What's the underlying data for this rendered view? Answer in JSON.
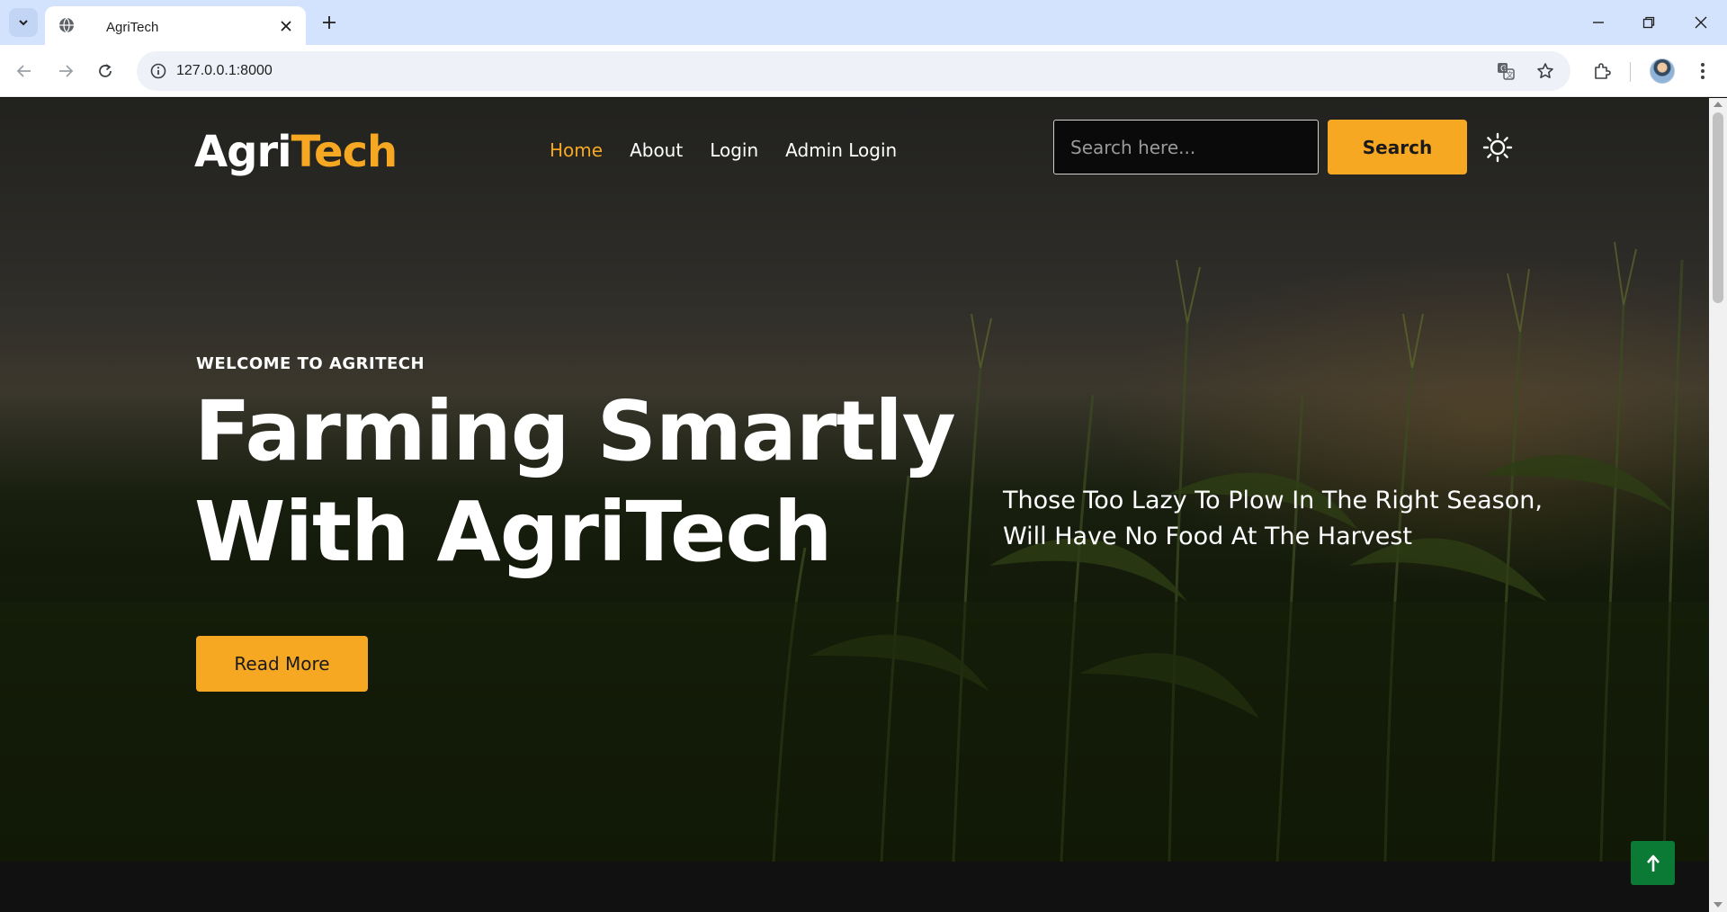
{
  "browser": {
    "tab_title": "AgriTech",
    "url": "127.0.0.1:8000"
  },
  "site": {
    "logo_part1": "Agri",
    "logo_part2": "Tech",
    "nav": [
      {
        "label": "Home",
        "active": true
      },
      {
        "label": "About",
        "active": false
      },
      {
        "label": "Login",
        "active": false
      },
      {
        "label": "Admin Login",
        "active": false
      }
    ],
    "search_placeholder": "Search here...",
    "search_button": "Search"
  },
  "hero": {
    "welcome": "WELCOME TO AGRITECH",
    "headline_line1": "Farming Smartly",
    "headline_line2": "With AgriTech",
    "quote_line1": "Those Too Lazy To Plow In The Right Season,",
    "quote_line2": "Will Have No Food At The Harvest",
    "read_more": "Read More"
  },
  "colors": {
    "accent": "#f7a823",
    "back_to_top": "#0b7a34",
    "tabbar": "#d3e3fd"
  },
  "icons": {
    "theme_toggle": "sun-icon",
    "back_to_top": "arrow-up-icon"
  }
}
